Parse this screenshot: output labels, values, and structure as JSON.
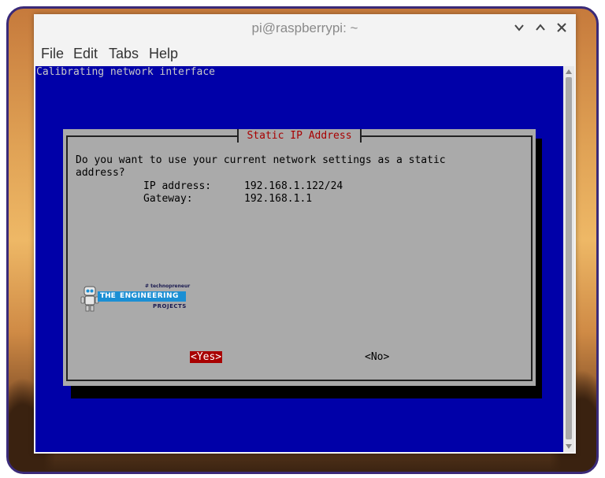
{
  "window": {
    "title": "pi@raspberrypi: ~"
  },
  "menu": {
    "items": [
      "File",
      "Edit",
      "Tabs",
      "Help"
    ]
  },
  "terminal": {
    "status_line": "Calibrating network interface",
    "background_color": "#0000a8"
  },
  "dialog": {
    "title": "Static IP Address",
    "question_line1": "Do you want to use your current network settings as a static",
    "question_line2": "address?",
    "ip_label": "IP address:",
    "ip_value": "192.168.1.122/24",
    "gateway_label": "Gateway:",
    "gateway_value": "192.168.1.1",
    "yes_label": "<Yes>",
    "no_label": "<No>",
    "selected": "yes"
  },
  "watermark": {
    "hashtag": "# technopreneur",
    "line_the": "THE",
    "line_engineering": "ENGINEERING",
    "line_projects": "PROJECTS",
    "brand_color": "#1b8fd4"
  }
}
